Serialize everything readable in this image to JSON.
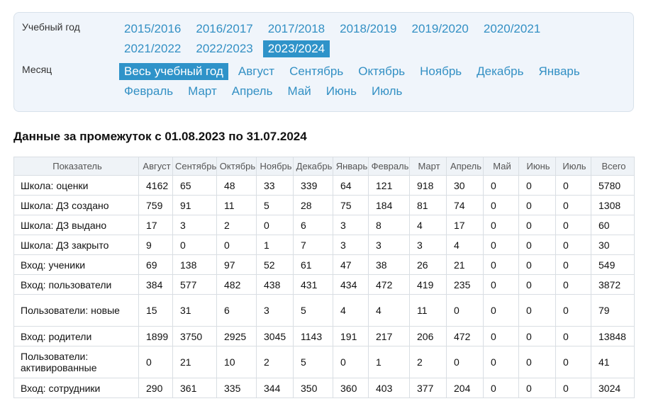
{
  "filters": {
    "year_label": "Учебный год",
    "month_label": "Месяц",
    "years": [
      "2015/2016",
      "2016/2017",
      "2017/2018",
      "2018/2019",
      "2019/2020",
      "2020/2021",
      "2021/2022",
      "2022/2023",
      "2023/2024"
    ],
    "selected_year": "2023/2024",
    "months": [
      "Весь учебный год",
      "Август",
      "Сентябрь",
      "Октябрь",
      "Ноябрь",
      "Декабрь",
      "Январь",
      "Февраль",
      "Март",
      "Апрель",
      "Май",
      "Июнь",
      "Июль"
    ],
    "selected_month": "Весь учебный год"
  },
  "heading": "Данные за промежуток с 01.08.2023 по 31.07.2024",
  "table": {
    "columns": [
      "Показатель",
      "Август",
      "Сентябрь",
      "Октябрь",
      "Ноябрь",
      "Декабрь",
      "Январь",
      "Февраль",
      "Март",
      "Апрель",
      "Май",
      "Июнь",
      "Июль",
      "Всего"
    ],
    "rows": [
      {
        "label": "Школа: оценки",
        "values": [
          "4162",
          "65",
          "48",
          "33",
          "339",
          "64",
          "121",
          "918",
          "30",
          "0",
          "0",
          "0",
          "5780"
        ]
      },
      {
        "label": "Школа: ДЗ создано",
        "values": [
          "759",
          "91",
          "11",
          "5",
          "28",
          "75",
          "184",
          "81",
          "74",
          "0",
          "0",
          "0",
          "1308"
        ]
      },
      {
        "label": "Школа: ДЗ выдано",
        "values": [
          "17",
          "3",
          "2",
          "0",
          "6",
          "3",
          "8",
          "4",
          "17",
          "0",
          "0",
          "0",
          "60"
        ]
      },
      {
        "label": "Школа: ДЗ закрыто",
        "values": [
          "9",
          "0",
          "0",
          "1",
          "7",
          "3",
          "3",
          "3",
          "4",
          "0",
          "0",
          "0",
          "30"
        ]
      },
      {
        "label": "Вход: ученики",
        "values": [
          "69",
          "138",
          "97",
          "52",
          "61",
          "47",
          "38",
          "26",
          "21",
          "0",
          "0",
          "0",
          "549"
        ]
      },
      {
        "label": "Вход: пользователи",
        "values": [
          "384",
          "577",
          "482",
          "438",
          "431",
          "434",
          "472",
          "419",
          "235",
          "0",
          "0",
          "0",
          "3872"
        ]
      },
      {
        "label": "Пользователи: новые",
        "values": [
          "15",
          "31",
          "6",
          "3",
          "5",
          "4",
          "4",
          "11",
          "0",
          "0",
          "0",
          "0",
          "79"
        ]
      },
      {
        "label": "Вход: родители",
        "values": [
          "1899",
          "3750",
          "2925",
          "3045",
          "1143",
          "191",
          "217",
          "206",
          "472",
          "0",
          "0",
          "0",
          "13848"
        ]
      },
      {
        "label": "Пользователи: активированные",
        "values": [
          "0",
          "21",
          "10",
          "2",
          "5",
          "0",
          "1",
          "2",
          "0",
          "0",
          "0",
          "0",
          "41"
        ]
      },
      {
        "label": "Вход: сотрудники",
        "values": [
          "290",
          "361",
          "335",
          "344",
          "350",
          "360",
          "403",
          "377",
          "204",
          "0",
          "0",
          "0",
          "3024"
        ]
      }
    ]
  }
}
